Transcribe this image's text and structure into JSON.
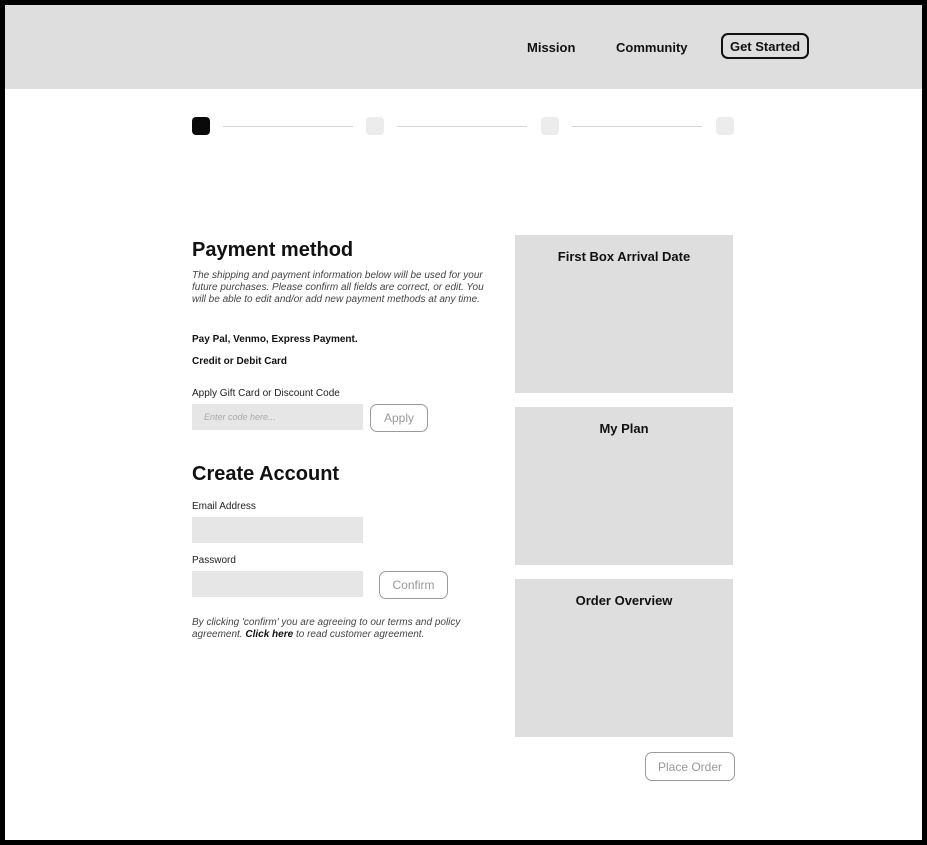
{
  "nav": {
    "mission": "Mission",
    "community": "Community",
    "get_started": "Get Started"
  },
  "progress": {
    "current_step": 1,
    "total_steps": 4
  },
  "payment": {
    "title": "Payment method",
    "description": "The shipping and payment information below will be used for your future purchases. Please confirm all fields are correct, or edit. You will be able to edit and/or add new payment methods at any time.",
    "option_express": "Pay Pal, Venmo, Express Payment.",
    "option_card": "Credit or Debit Card",
    "gift_label": "Apply Gift Card or Discount Code",
    "gift_placeholder": "Enter code here...",
    "apply_label": "Apply"
  },
  "account": {
    "title": "Create Account",
    "email_label": "Email Address",
    "email_value": "",
    "password_label": "Password",
    "password_value": "",
    "confirm_label": "Confirm",
    "terms_prefix": "By clicking 'confirm' you are agreeing to our terms and policy agreement.",
    "terms_link": "Click here",
    "terms_suffix": "to read customer agreement."
  },
  "summary": {
    "arrival_title": "First Box Arrival Date",
    "plan_title": "My Plan",
    "overview_title": "Order Overview",
    "place_order_label": "Place Order"
  }
}
